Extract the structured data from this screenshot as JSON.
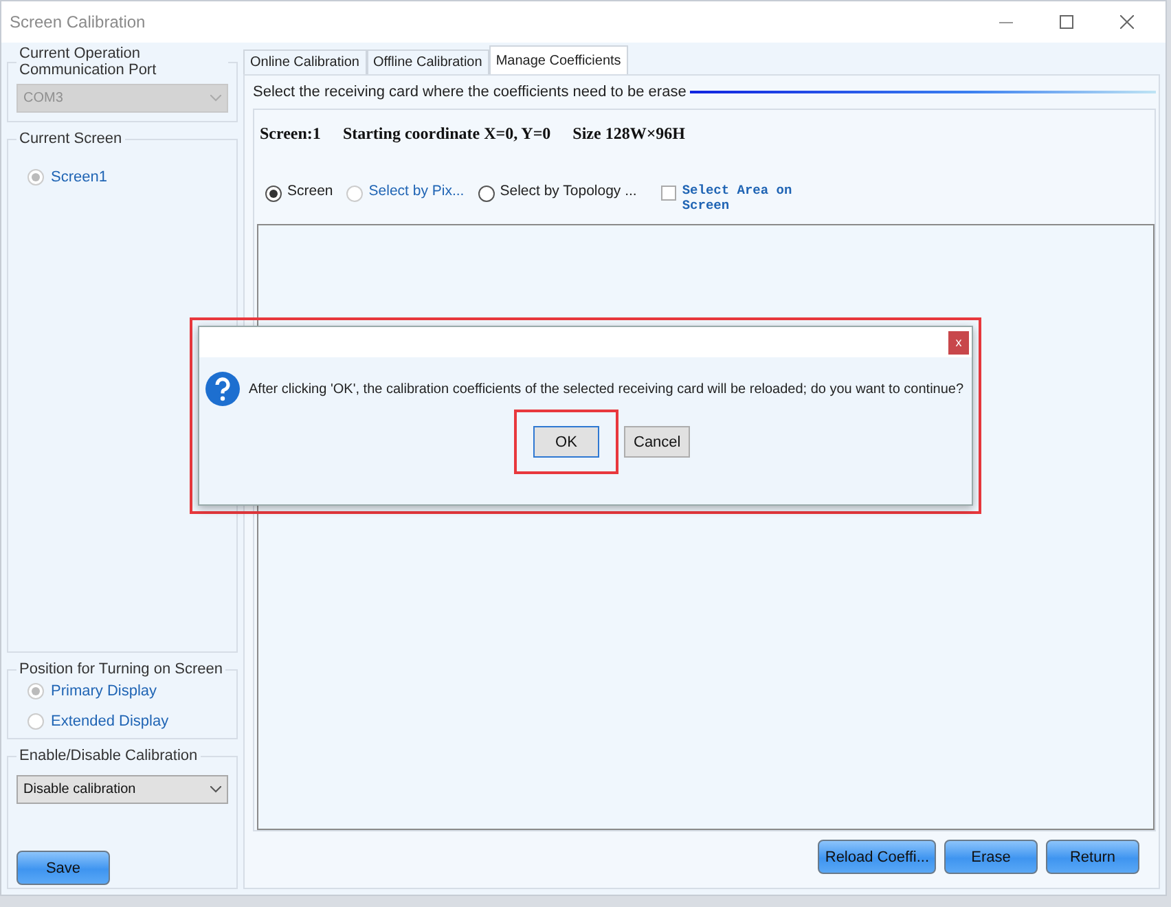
{
  "window": {
    "title": "Screen Calibration"
  },
  "sidebar": {
    "port_group": {
      "title": "Current Operation Communication Port",
      "port": {
        "value": "COM3",
        "disabled": true
      }
    },
    "screen_group": {
      "title": "Current Screen",
      "screens": [
        {
          "label": "Screen1",
          "selected": true
        }
      ]
    },
    "position_group": {
      "title": "Position for Turning on Screen",
      "options": [
        {
          "label": "Primary Display",
          "selected": true
        },
        {
          "label": "Extended Display",
          "selected": false
        }
      ]
    },
    "calibration_group": {
      "title": "Enable/Disable Calibration",
      "select": {
        "value": "Disable calibration",
        "disabled": false
      }
    },
    "save_button": "Save"
  },
  "tabs": [
    {
      "label": "Online Calibration",
      "selected": false
    },
    {
      "label": "Offline Calibration",
      "selected": false
    },
    {
      "label": "Manage Coefficients",
      "selected": true
    }
  ],
  "section_title": "Select the receiving card where the coefficients need to be erase",
  "screen_info": [
    "Screen:1",
    "Starting coordinate X=0, Y=0",
    "Size 128W×96H"
  ],
  "selection_options": [
    {
      "kind": "radio",
      "label": "Screen",
      "selected": true,
      "disabled": false
    },
    {
      "kind": "radio",
      "label": "Select by Pix...",
      "selected": false,
      "disabled": true
    },
    {
      "kind": "radio",
      "label": "Select by Topology ...",
      "selected": false,
      "disabled": false
    },
    {
      "kind": "checkbox",
      "label": "Select Area on Screen",
      "checked": false
    }
  ],
  "buttons": [
    "Reload Coeffi...",
    "Erase",
    "Return"
  ],
  "dialog": {
    "highlighted": true,
    "close": "x",
    "message": "After clicking 'OK', the calibration coefficients of the selected receiving card will be reloaded; do you want to continue?",
    "buttons": [
      {
        "label": "OK",
        "highlighted": true
      },
      {
        "label": "Cancel",
        "highlighted": false
      }
    ]
  }
}
